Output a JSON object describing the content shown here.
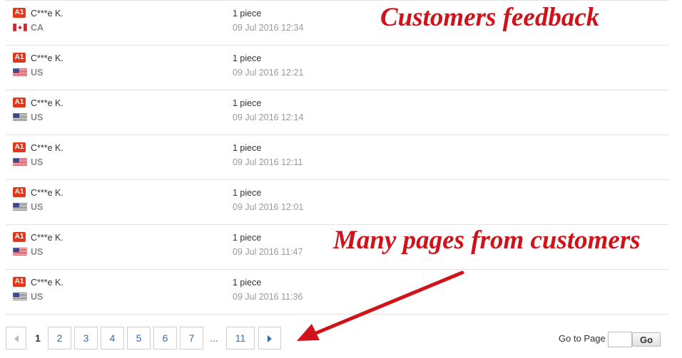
{
  "feedback": {
    "rows": [
      {
        "badge": "A1",
        "name": "C***e K.",
        "country": "CA",
        "flag": "ca-flag-icon",
        "quantity": "1 piece",
        "date": "09 Jul 2016 12:34"
      },
      {
        "badge": "A1",
        "name": "C***e K.",
        "country": "US",
        "flag": "us-flag-icon",
        "quantity": "1 piece",
        "date": "09 Jul 2016 12:21"
      },
      {
        "badge": "A1",
        "name": "C***e K.",
        "country": "US",
        "flag": "us-flag-icon",
        "quantity": "1 piece",
        "date": "09 Jul 2016 12:14"
      },
      {
        "badge": "A1",
        "name": "C***e K.",
        "country": "US",
        "flag": "us-flag-icon",
        "quantity": "1 piece",
        "date": "09 Jul 2016 12:11"
      },
      {
        "badge": "A1",
        "name": "C***e K.",
        "country": "US",
        "flag": "us-flag-icon",
        "quantity": "1 piece",
        "date": "09 Jul 2016 12:01"
      },
      {
        "badge": "A1",
        "name": "C***e K.",
        "country": "US",
        "flag": "us-flag-icon",
        "quantity": "1 piece",
        "date": "09 Jul 2016 11:47"
      },
      {
        "badge": "A1",
        "name": "C***e K.",
        "country": "US",
        "flag": "us-flag-icon",
        "quantity": "1 piece",
        "date": "09 Jul 2016 11:36"
      }
    ]
  },
  "annotations": {
    "top": "Customers feedback",
    "middle": "Many pages from customers",
    "color": "#d0121b"
  },
  "pagination": {
    "prev_icon": "chevron-left-icon",
    "next_icon": "chevron-right-icon",
    "current": "1",
    "pages": [
      "2",
      "3",
      "4",
      "5",
      "6",
      "7"
    ],
    "ellipsis": "...",
    "last": "11",
    "goto_label": "Go to Page",
    "goto_value": "",
    "go_label": "Go"
  },
  "colors": {
    "badge": "#e0381c",
    "link": "#2a6fbf",
    "muted": "#9a9a9a"
  }
}
